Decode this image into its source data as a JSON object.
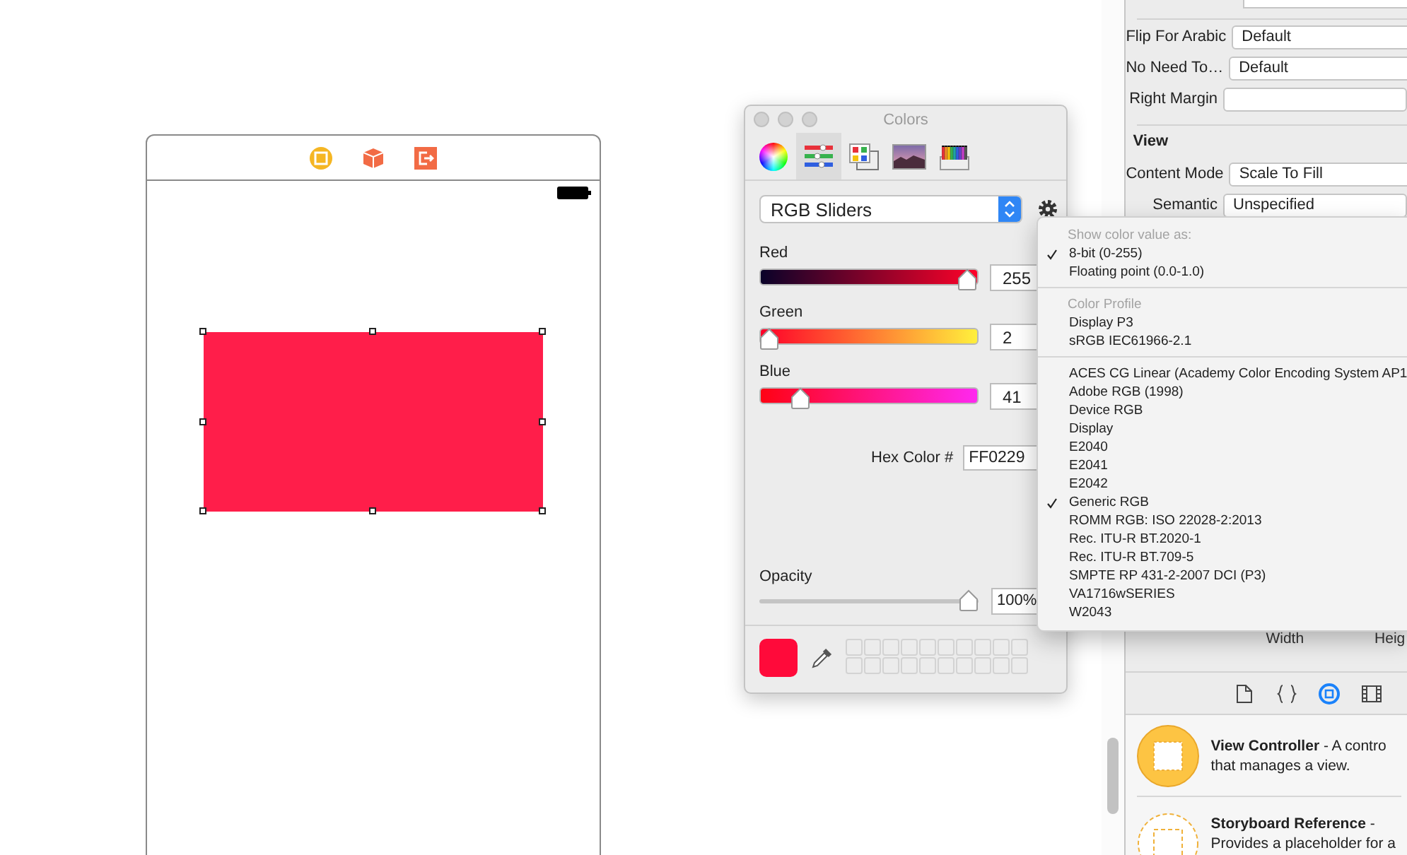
{
  "colors_window": {
    "title": "Colors",
    "tabs": [
      {
        "kind": "wheel",
        "selected": false
      },
      {
        "kind": "sliders",
        "selected": true
      },
      {
        "kind": "palettes",
        "selected": false
      },
      {
        "kind": "image",
        "selected": false
      },
      {
        "kind": "pencils",
        "selected": false
      }
    ],
    "mode_popup": {
      "value": "RGB Sliders"
    },
    "channels": [
      {
        "kind": "red",
        "name": "Red",
        "level": 1,
        "value": "255"
      },
      {
        "kind": "green",
        "name": "Green",
        "level": 0.01,
        "value": "2"
      },
      {
        "kind": "blue",
        "name": "Blue",
        "level": 0.16,
        "value": "41"
      }
    ],
    "hex": {
      "label": "Hex Color #",
      "value": "FF0229"
    },
    "opacity": {
      "label": "Opacity",
      "level": 1,
      "value": "100%"
    }
  },
  "options_menu": {
    "sections": [
      {
        "header": "Show color value as:",
        "items": [
          {
            "label": "8-bit (0-255)",
            "checked": true
          },
          {
            "label": "Floating point (0.0-1.0)",
            "checked": false
          }
        ]
      },
      {
        "header": "Color Profile",
        "items": [
          {
            "label": "Display P3",
            "checked": false
          },
          {
            "label": "sRGB IEC61966-2.1",
            "checked": false
          }
        ]
      },
      {
        "items": [
          {
            "label": "ACES CG Linear (Academy Color Encoding System AP1",
            "checked": false
          },
          {
            "label": "Adobe RGB (1998)",
            "checked": false
          },
          {
            "label": "Device RGB",
            "checked": false
          },
          {
            "label": "Display",
            "checked": false
          },
          {
            "label": "E2040",
            "checked": false
          },
          {
            "label": "E2041",
            "checked": false
          },
          {
            "label": "E2042",
            "checked": false
          },
          {
            "label": "Generic RGB",
            "checked": true
          },
          {
            "label": "ROMM RGB: ISO 22028-2:2013",
            "checked": false
          },
          {
            "label": "Rec. ITU-R BT.2020-1",
            "checked": false
          },
          {
            "label": "Rec. ITU-R BT.709-5",
            "checked": false
          },
          {
            "label": "SMPTE RP 431-2-2007 DCI (P3)",
            "checked": false
          },
          {
            "label": "VA1716wSERIES",
            "checked": false
          },
          {
            "label": "W2043",
            "checked": false
          }
        ]
      }
    ]
  },
  "inspector": {
    "rows": [
      {
        "label": "Flip For Arabic",
        "value": "Default"
      },
      {
        "label": "No Need To…",
        "value": "Default"
      },
      {
        "label": "Right Margin"
      }
    ],
    "view_section": {
      "title": "View",
      "rows": [
        {
          "label": "Content Mode",
          "value": "Scale To Fill"
        },
        {
          "label": "Semantic",
          "value": "Unspecified"
        }
      ]
    },
    "size_labels": [
      "Width",
      "Heig"
    ],
    "library_tabs": [
      {
        "kind": "file",
        "selected": false
      },
      {
        "kind": "braces",
        "selected": false
      },
      {
        "kind": "object",
        "selected": true
      },
      {
        "kind": "media",
        "selected": false
      }
    ],
    "library_items": [
      {
        "kind": "solid",
        "line1": "**View Controller** - A contro",
        "line2": "that manages a view."
      },
      {
        "kind": "dashed",
        "line1": "**Storyboard Reference** -",
        "line2": "Provides a placeholder for a"
      }
    ]
  }
}
